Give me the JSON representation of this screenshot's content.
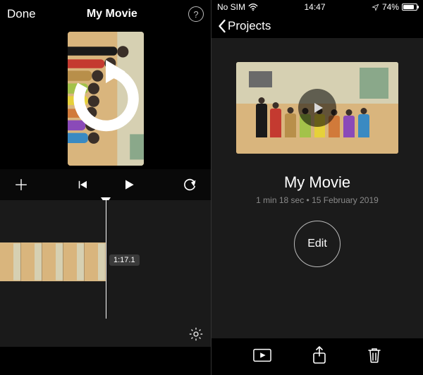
{
  "left": {
    "done": "Done",
    "title": "My Movie",
    "rotate_icon": "rotate-clockwise-icon",
    "transport": {
      "add": "add-icon",
      "prev": "skip-back-icon",
      "play": "play-icon",
      "undo": "undo-icon"
    },
    "timeline": {
      "duration_label": "1:17.1"
    },
    "gear": "settings-icon"
  },
  "right": {
    "status": {
      "carrier": "No SIM",
      "wifi": "wifi-icon",
      "time": "14:47",
      "loc": "location-icon",
      "batt_pct": "74%"
    },
    "nav": {
      "back_label": "Projects"
    },
    "project": {
      "title": "My Movie",
      "meta": "1 min 18 sec • 15 February 2019",
      "edit_label": "Edit"
    },
    "toolbar": {
      "play": "play-box-icon",
      "share": "share-icon",
      "trash": "trash-icon"
    }
  }
}
